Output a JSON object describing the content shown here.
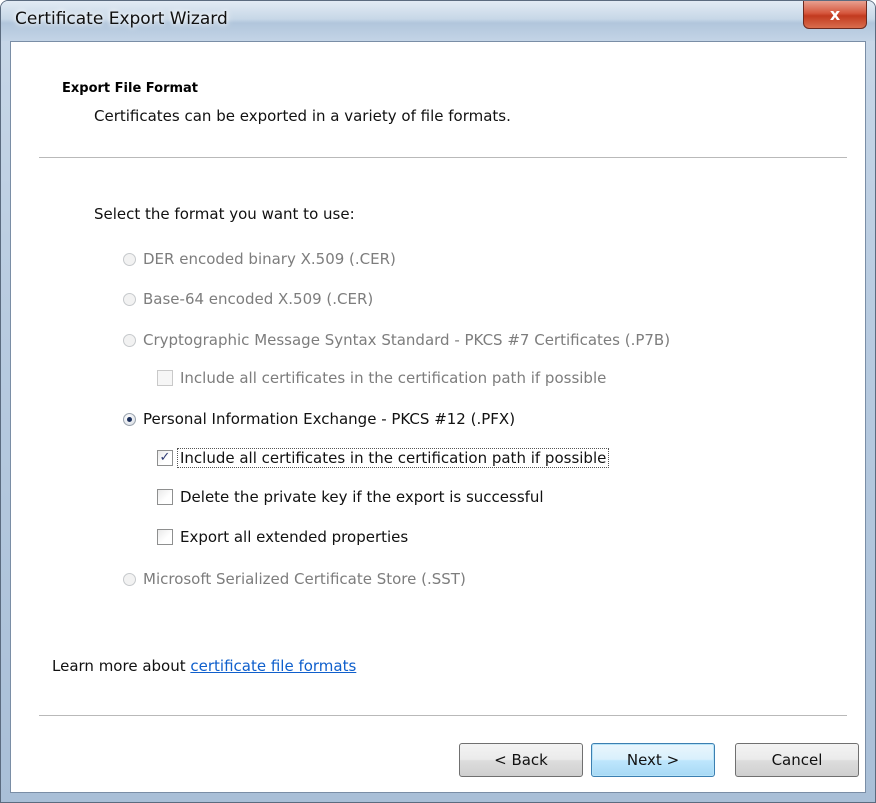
{
  "window": {
    "title": "Certificate Export Wizard",
    "close_glyph": "x"
  },
  "header": {
    "title": "Export File Format",
    "description": "Certificates can be exported in a variety of file formats."
  },
  "form": {
    "prompt": "Select the format you want to use:",
    "options": [
      {
        "label": "DER encoded binary X.509 (.CER)",
        "selected": false,
        "enabled": false
      },
      {
        "label": "Base-64 encoded X.509 (.CER)",
        "selected": false,
        "enabled": false
      },
      {
        "label": "Cryptographic Message Syntax Standard - PKCS #7 Certificates (.P7B)",
        "selected": false,
        "enabled": false
      },
      {
        "label": "Personal Information Exchange - PKCS #12 (.PFX)",
        "selected": true,
        "enabled": true
      },
      {
        "label": "Microsoft Serialized Certificate Store (.SST)",
        "selected": false,
        "enabled": false
      }
    ],
    "checkboxes": [
      {
        "label": "Include all certificates in the certification path if possible",
        "checked": false,
        "enabled": false
      },
      {
        "label": "Include all certificates in the certification path if possible",
        "checked": true,
        "enabled": true
      },
      {
        "label": "Delete the private key if the export is successful",
        "checked": false,
        "enabled": true
      },
      {
        "label": "Export all extended properties",
        "checked": false,
        "enabled": true
      }
    ]
  },
  "learn_more": {
    "prefix": "Learn more about ",
    "link": "certificate file formats"
  },
  "buttons": {
    "back": "< Back",
    "next": "Next >",
    "cancel": "Cancel"
  }
}
